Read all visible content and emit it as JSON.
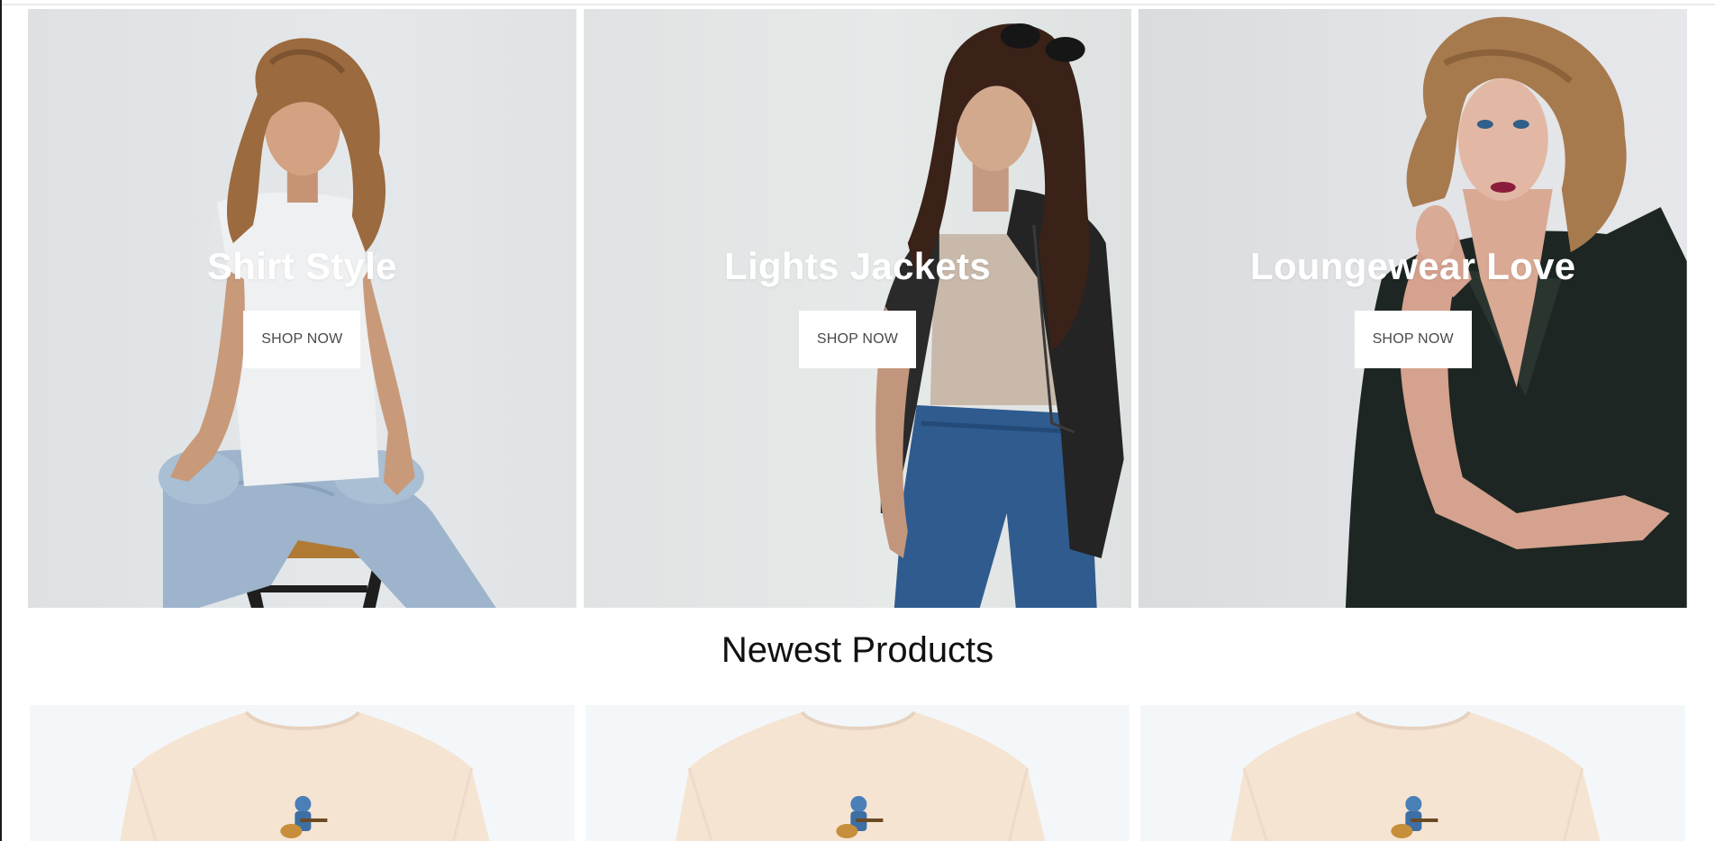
{
  "banners": [
    {
      "title": "Shirt Style",
      "button": "SHOP NOW"
    },
    {
      "title": "Lights Jackets",
      "button": "SHOP NOW"
    },
    {
      "title": "Loungewear Love",
      "button": "SHOP NOW"
    }
  ],
  "section": {
    "title": "Newest Products"
  },
  "products": [
    {
      "image": "cream-graphic-tshirt"
    },
    {
      "image": "cream-graphic-tshirt"
    },
    {
      "image": "cream-graphic-tshirt"
    }
  ]
}
